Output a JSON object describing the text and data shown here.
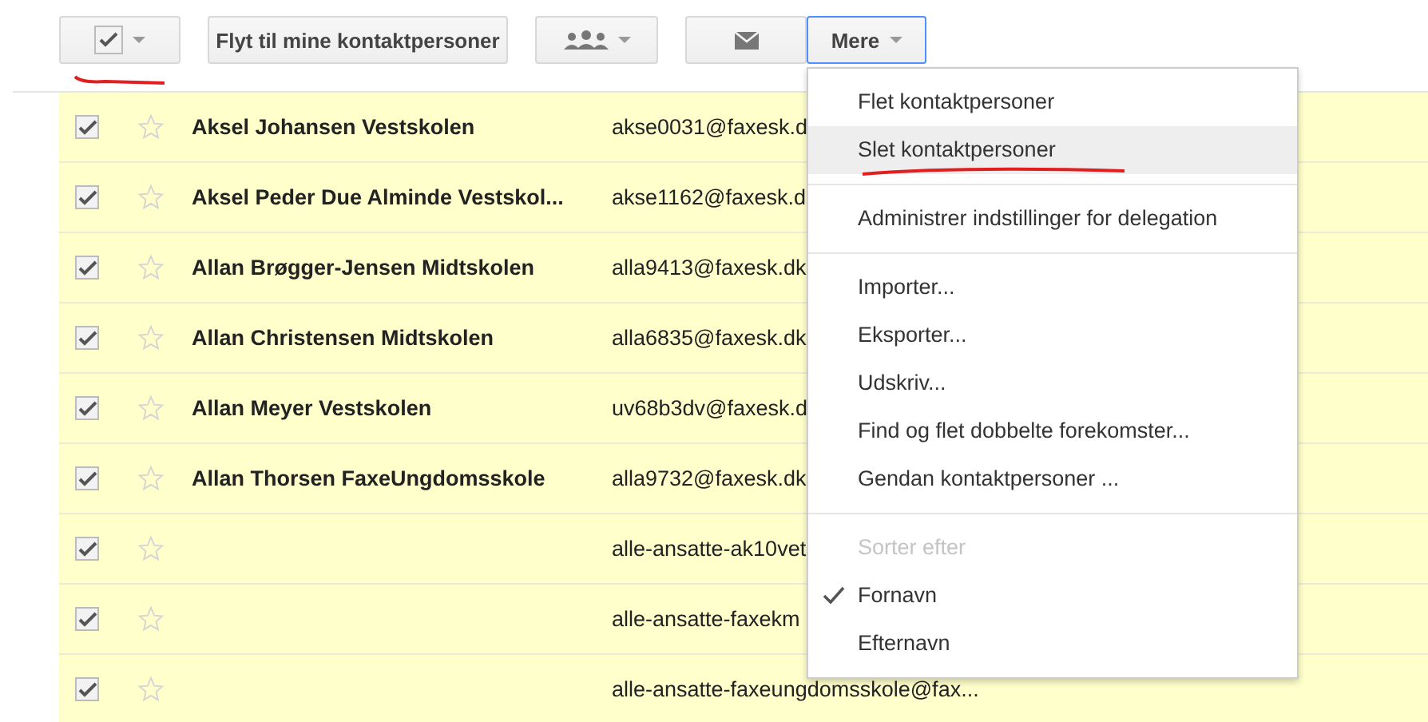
{
  "toolbar": [
    {
      "kind": "select",
      "checked": true,
      "underlined": true,
      "active": false
    },
    {
      "kind": "text",
      "label": "Flyt til mine kontaktpersoner",
      "active": false
    },
    {
      "kind": "groups",
      "active": false
    },
    {
      "kind": "mail",
      "active": false
    },
    {
      "kind": "menu",
      "label": "Mere",
      "active": true
    }
  ],
  "rows": [
    {
      "checked": true,
      "starred": false,
      "name": "Aksel Johansen Vestskolen",
      "email": "akse0031@faxesk.d"
    },
    {
      "checked": true,
      "starred": false,
      "name": "Aksel Peder Due Alminde Vestskol...",
      "email": "akse1162@faxesk.d"
    },
    {
      "checked": true,
      "starred": false,
      "name": "Allan Brøgger-Jensen Midtskolen",
      "email": "alla9413@faxesk.dk"
    },
    {
      "checked": true,
      "starred": false,
      "name": "Allan Christensen Midtskolen",
      "email": "alla6835@faxesk.dk"
    },
    {
      "checked": true,
      "starred": false,
      "name": "Allan Meyer Vestskolen",
      "email": "uv68b3dv@faxesk.d"
    },
    {
      "checked": true,
      "starred": false,
      "name": "Allan Thorsen FaxeUngdomsskole",
      "email": "alla9732@faxesk.dk"
    },
    {
      "checked": true,
      "starred": false,
      "email": "alle-ansatte-ak10vet"
    },
    {
      "checked": true,
      "starred": false,
      "email": "alle-ansatte-faxekm"
    },
    {
      "checked": true,
      "starred": false,
      "email": "alle-ansatte-faxeungdomsskole@fax..."
    }
  ],
  "menu": [
    {
      "kind": "item",
      "label": "Flet kontaktpersoner",
      "highlighted": false,
      "underlined": false
    },
    {
      "kind": "item",
      "label": "Slet kontaktpersoner",
      "highlighted": true,
      "underlined": true
    },
    {
      "kind": "divider"
    },
    {
      "kind": "item",
      "label": "Administrer indstillinger for delegation",
      "highlighted": false,
      "underlined": false
    },
    {
      "kind": "divider"
    },
    {
      "kind": "item",
      "label": "Importer...",
      "highlighted": false,
      "underlined": false
    },
    {
      "kind": "item",
      "label": "Eksporter...",
      "highlighted": false,
      "underlined": false
    },
    {
      "kind": "item",
      "label": "Udskriv...",
      "highlighted": false,
      "underlined": false
    },
    {
      "kind": "item",
      "label": "Find og flet dobbelte forekomster...",
      "highlighted": false,
      "underlined": false
    },
    {
      "kind": "item",
      "label": "Gendan kontaktpersoner ...",
      "highlighted": false,
      "underlined": false
    },
    {
      "kind": "divider"
    },
    {
      "kind": "header",
      "label": "Sorter efter"
    },
    {
      "kind": "option",
      "label": "Fornavn",
      "checked": true
    },
    {
      "kind": "option",
      "label": "Efternavn",
      "checked": false
    }
  ]
}
